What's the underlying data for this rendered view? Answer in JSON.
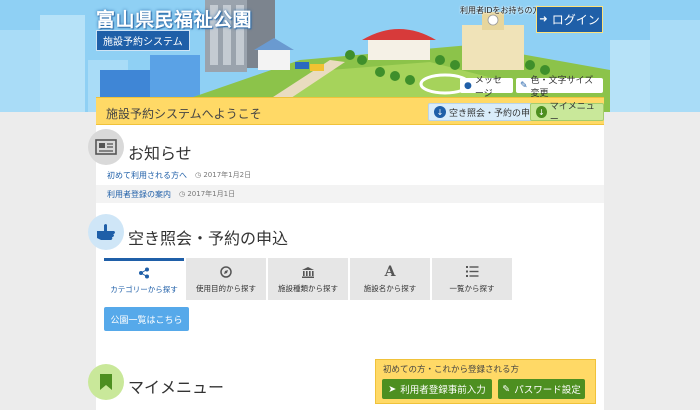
{
  "header": {
    "site_title": "富山県民福祉公園",
    "subtitle": "施設予約システム",
    "user_caption": "利用者IDをお持ちの方",
    "login_label": "ログイン",
    "message_label": "メッセージ",
    "display_label": "色・文字サイズ変更"
  },
  "welcome": {
    "text": "施設予約システムへようこそ",
    "availability_label": "空き照会・予約の申込",
    "mymenu_label": "マイメニュー"
  },
  "news": {
    "title": "お知らせ",
    "items": [
      {
        "label": "初めて利用される方へ",
        "date": "2017年1月2日"
      },
      {
        "label": "利用者登録の案内",
        "date": "2017年1月1日"
      }
    ]
  },
  "reservation": {
    "title": "空き照会・予約の申込",
    "tabs": [
      {
        "label": "カテゴリーから探す",
        "icon": "share-icon"
      },
      {
        "label": "使用目的から探す",
        "icon": "compass-icon"
      },
      {
        "label": "施設種類から探す",
        "icon": "bank-icon"
      },
      {
        "label": "施設名から探す",
        "icon": "font-icon"
      },
      {
        "label": "一覧から探す",
        "icon": "list-icon"
      }
    ],
    "list_button": "公園一覧はこちら"
  },
  "mymenu": {
    "title": "マイメニュー"
  },
  "first_time": {
    "caption": "初めての方・これから登録される方",
    "register_label": "利用者登録事前入力",
    "password_label": "パスワード設定"
  },
  "colors": {
    "brand_blue": "#1f5fa8",
    "yellow": "#ffd966",
    "green": "#4d8f20",
    "sky": "#8fd0f4"
  }
}
